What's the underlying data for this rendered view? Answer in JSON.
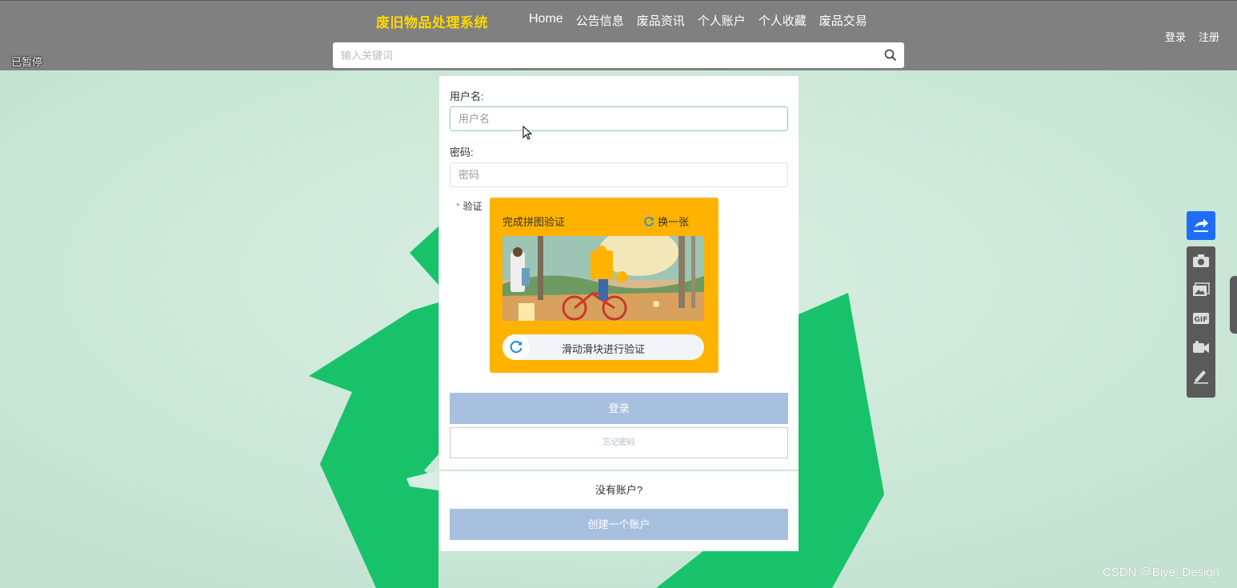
{
  "header": {
    "brand": "废旧物品处理系统",
    "nav": [
      "Home",
      "公告信息",
      "废品资讯",
      "个人账户",
      "个人收藏",
      "废品交易"
    ],
    "search_placeholder": "输入关键词",
    "login": "登录",
    "register": "注册",
    "paused": "已暂停"
  },
  "form": {
    "username_label": "用户名:",
    "username_placeholder": "用户名",
    "password_label": "密码:",
    "password_placeholder": "密码",
    "verify_label": "验证",
    "captcha_title": "完成拼图验证",
    "captcha_refresh": "换一张",
    "slider_text": "滑动滑块进行验证",
    "login_button": "登录",
    "forgot_button": "忘记密码",
    "no_account": "没有账户?",
    "create_button": "创建一个账户"
  },
  "watermark": "CSDN @Biye_Design",
  "colors": {
    "header_bg": "#808080",
    "brand": "#ffd800",
    "captcha_bg": "#ffb300",
    "primary_button": "#a8c0e0",
    "share_button": "#1e6df6"
  },
  "icons": [
    "search-icon",
    "refresh-icon",
    "share-icon",
    "camera-icon",
    "image-icon",
    "gif-icon",
    "video-icon",
    "edit-icon",
    "cursor-icon"
  ]
}
